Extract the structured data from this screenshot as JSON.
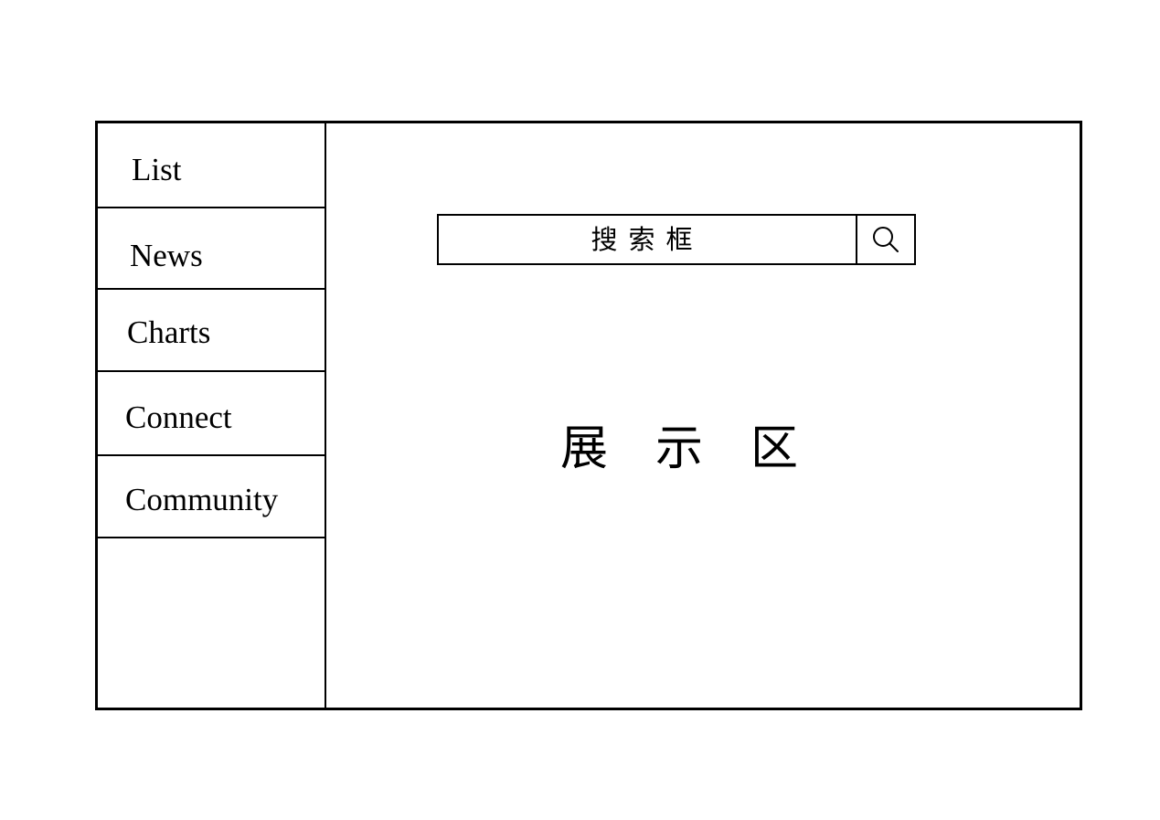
{
  "sidebar": {
    "items": [
      {
        "label": "List"
      },
      {
        "label": "News"
      },
      {
        "label": "Charts"
      },
      {
        "label": "Connect"
      },
      {
        "label": "Community"
      }
    ]
  },
  "search": {
    "placeholder": "搜索框",
    "icon": "search-icon"
  },
  "main": {
    "display_label": "展示区"
  },
  "colors": {
    "border": "#000000",
    "background": "#ffffff"
  }
}
